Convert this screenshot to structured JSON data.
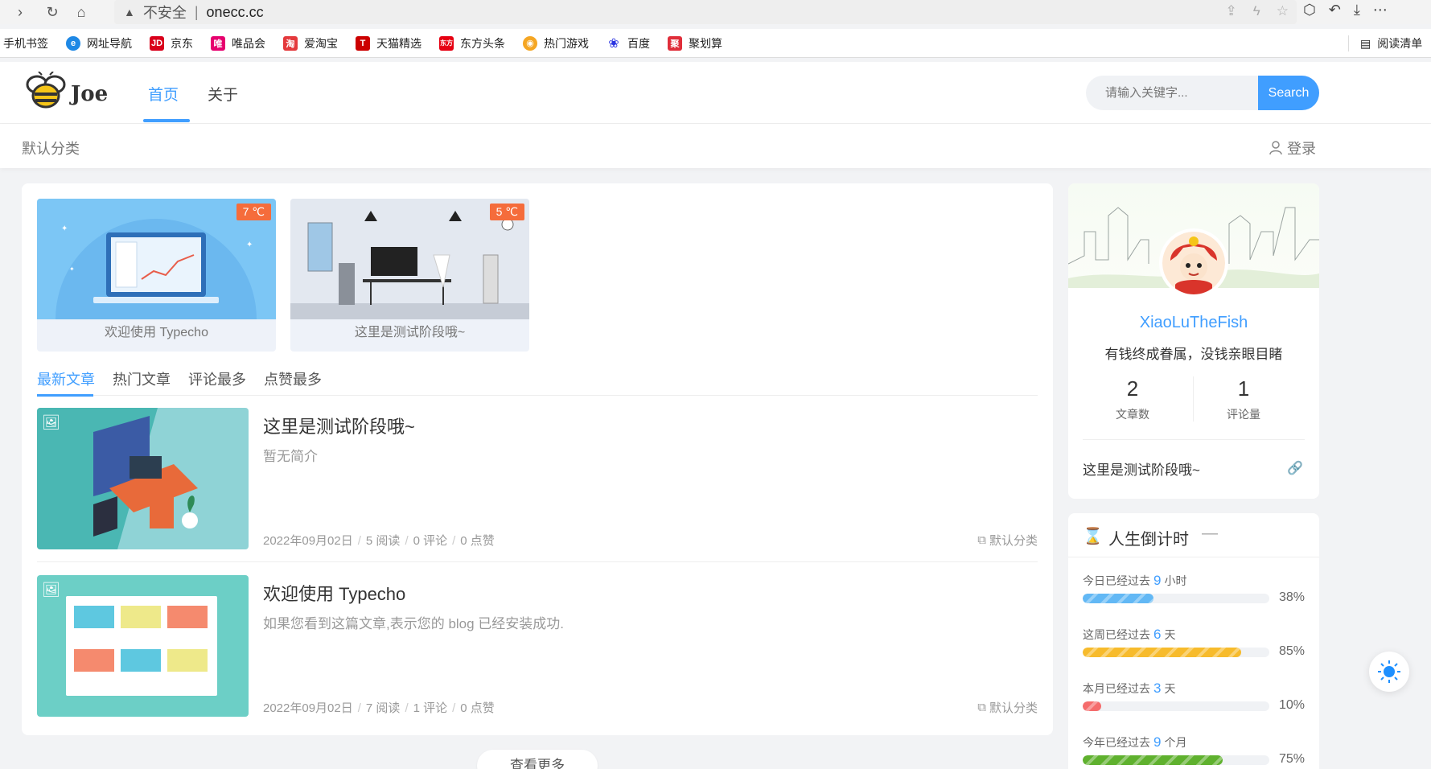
{
  "browser": {
    "insecure_label": "不安全",
    "url": "onecc.cc",
    "bookmarks": [
      {
        "label": "手机书签",
        "icon": "mobile-bookmark-icon",
        "color": "#ffffff"
      },
      {
        "label": "网址导航",
        "icon": "nav-icon",
        "color": "#1e88e5"
      },
      {
        "label": "京东",
        "icon": "jd-icon",
        "color": "#d9001b"
      },
      {
        "label": "唯品会",
        "icon": "vip-icon",
        "color": "#e6006e"
      },
      {
        "label": "爱淘宝",
        "icon": "taobao-icon",
        "color": "#e4393c"
      },
      {
        "label": "天猫精选",
        "icon": "tmall-icon",
        "color": "#cc0000"
      },
      {
        "label": "东方头条",
        "icon": "dftt-icon",
        "color": "#e60012"
      },
      {
        "label": "热门游戏",
        "icon": "game-icon",
        "color": "#f5a623"
      },
      {
        "label": "百度",
        "icon": "baidu-icon",
        "color": "#2932e1"
      },
      {
        "label": "聚划算",
        "icon": "juhuasuan-icon",
        "color": "#e02e3a"
      }
    ],
    "reading_list": "阅读清单"
  },
  "header": {
    "brand": "Joe",
    "nav": [
      "首页",
      "关于"
    ],
    "search_placeholder": "请输入关键字...",
    "search_button": "Search"
  },
  "subheader": {
    "category": "默认分类",
    "login": "登录"
  },
  "banners": [
    {
      "caption": "欢迎使用 Typecho",
      "temp": "7 ℃"
    },
    {
      "caption": "这里是测试阶段哦~",
      "temp": "5 ℃"
    }
  ],
  "tabs": [
    "最新文章",
    "热门文章",
    "评论最多",
    "点赞最多"
  ],
  "posts": [
    {
      "title": "这里是测试阶段哦~",
      "desc": "暂无简介",
      "date": "2022年09月02日",
      "views": "5 阅读",
      "comments": "0 评论",
      "likes": "0 点赞",
      "category": "默认分类"
    },
    {
      "title": "欢迎使用 Typecho",
      "desc": "如果您看到这篇文章,表示您的 blog 已经安装成功.",
      "date": "2022年09月02日",
      "views": "7 阅读",
      "comments": "1 评论",
      "likes": "0 点赞",
      "category": "默认分类"
    }
  ],
  "load_more": "查看更多",
  "profile": {
    "name": "XiaoLuTheFish",
    "motto": "有钱终成眷属，没钱亲眼目睹",
    "articles_count": "2",
    "articles_label": "文章数",
    "comments_count": "1",
    "comments_label": "评论量",
    "recent_link": "这里是测试阶段哦~"
  },
  "countdown": {
    "title": "人生倒计时",
    "items": [
      {
        "prefix": "今日已经过去",
        "num": "9",
        "unit": "小时",
        "percent": 38,
        "pct_label": "38%",
        "color": "#62b8f5"
      },
      {
        "prefix": "这周已经过去",
        "num": "6",
        "unit": "天",
        "percent": 85,
        "pct_label": "85%",
        "color": "#f7bb2c"
      },
      {
        "prefix": "本月已经过去",
        "num": "3",
        "unit": "天",
        "percent": 10,
        "pct_label": "10%",
        "color": "#f56c6c"
      },
      {
        "prefix": "今年已经过去",
        "num": "9",
        "unit": "个月",
        "percent": 75,
        "pct_label": "75%",
        "color": "#5fb12e"
      }
    ]
  },
  "colors": {
    "accent": "#409eff",
    "temp_badge": "#f56c3b"
  }
}
